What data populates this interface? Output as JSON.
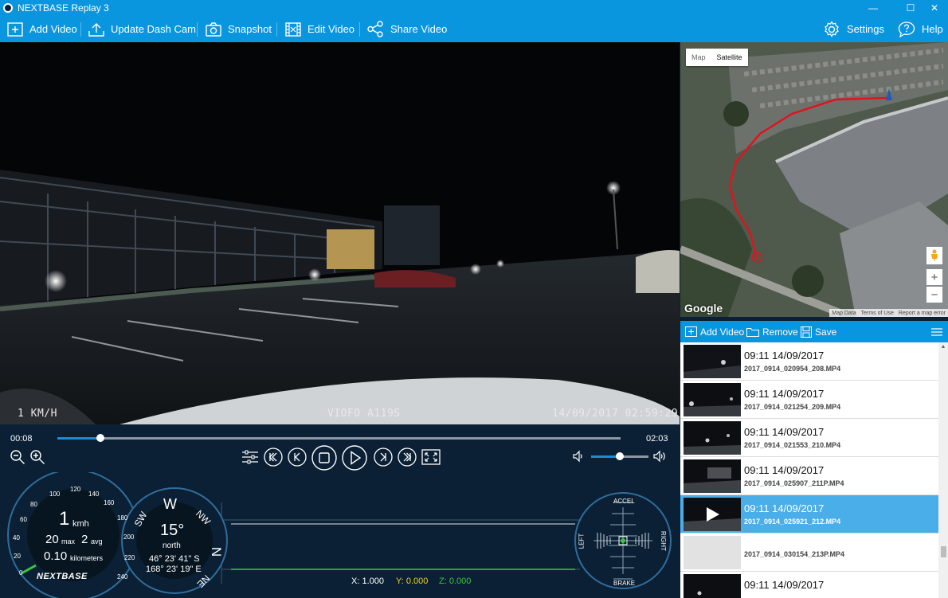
{
  "titlebar": {
    "title": "NEXTBASE Replay 3",
    "minimize": "—",
    "maximize": "☐",
    "close": "✕"
  },
  "toolbar": {
    "add_video": "Add Video",
    "update_dash_cam": "Update Dash Cam",
    "snapshot": "Snapshot",
    "edit_video": "Edit Video",
    "share_video": "Share Video",
    "settings": "Settings",
    "help": "Help"
  },
  "video": {
    "overlay_left": "1 KM/H",
    "overlay_center": "VIOFO A119S",
    "overlay_right": "14/09/2017 02:59:29"
  },
  "playback": {
    "current_time": "00:08",
    "duration": "02:03",
    "progress": 0.076,
    "volume": 0.5
  },
  "speedometer": {
    "scale": [
      "0",
      "20",
      "40",
      "60",
      "80",
      "100",
      "120",
      "140",
      "160",
      "180",
      "200",
      "220",
      "240"
    ],
    "speed": "1",
    "unit": "kmh",
    "max_value": "20",
    "max_label": "max",
    "avg_value": "2",
    "avg_label": "avg",
    "distance": "0.10",
    "distance_unit": "kilometers",
    "brand": "NEXTBASE"
  },
  "compass": {
    "letters": [
      "SW",
      "W",
      "NW",
      "N",
      "NE"
    ],
    "bearing": "15°",
    "direction": "north",
    "latitude": "46° 23' 41\" S",
    "longitude": "168° 23' 19\" E"
  },
  "gsensor": {
    "x_label": "X: 1.000",
    "y_label": "Y: 0.000",
    "z_label": "Z: 0.000"
  },
  "gforce_pad": {
    "accel": "ACCEL",
    "brake": "BRAKE",
    "left": "LEFT",
    "right": "RIGHT"
  },
  "map": {
    "type_map": "Map",
    "type_satellite": "Satellite",
    "zoom_in": "+",
    "zoom_out": "−",
    "logo": "Google",
    "footer": [
      "Map Data",
      "Terms of Use",
      "Report a map error"
    ]
  },
  "playlist": {
    "add_video": "Add Video",
    "remove": "Remove",
    "save": "Save",
    "items": [
      {
        "time": "09:11 14/09/2017",
        "file": "2017_0914_020954_208.MP4"
      },
      {
        "time": "09:11 14/09/2017",
        "file": "2017_0914_021254_209.MP4"
      },
      {
        "time": "09:11 14/09/2017",
        "file": "2017_0914_021553_210.MP4"
      },
      {
        "time": "09:11 14/09/2017",
        "file": "2017_0914_025907_211P.MP4"
      },
      {
        "time": "09:11 14/09/2017",
        "file": "2017_0914_025921_212.MP4"
      },
      {
        "time": "",
        "file": "2017_0914_030154_213P.MP4"
      },
      {
        "time": "09:11 14/09/2017",
        "file": ""
      }
    ]
  },
  "colors": {
    "accent": "#0a95df",
    "panel": "#0b2034",
    "selected": "#4aaee8",
    "route": "#e0141e",
    "gsensor_y": "#f2d024",
    "gsensor_z": "#39c93b"
  }
}
